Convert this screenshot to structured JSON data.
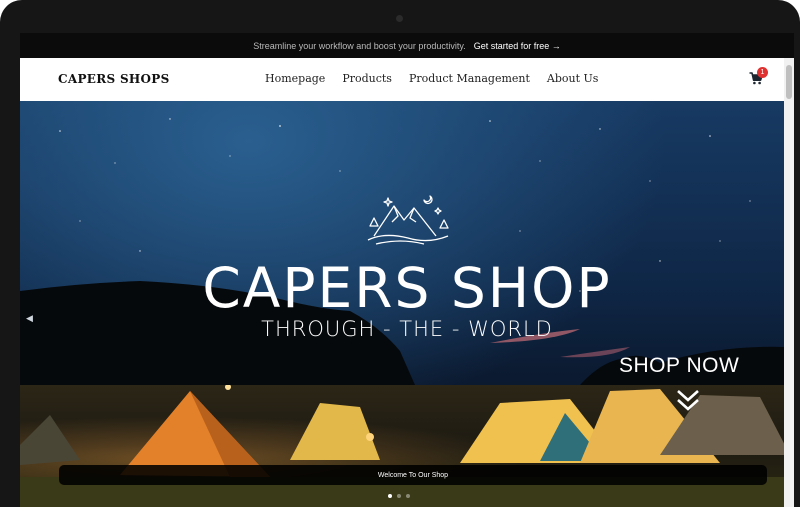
{
  "promo": {
    "text": "Streamline your workflow and boost your productivity.",
    "cta": "Get started for free",
    "cta_arrow": "→"
  },
  "nav": {
    "brand": "CAPERS SHOPS",
    "items": [
      {
        "label": "Homepage"
      },
      {
        "label": "Products"
      },
      {
        "label": "Product Management"
      },
      {
        "label": "About Us"
      }
    ],
    "cart_icon": "shopping-cart-icon",
    "cart_count": "1"
  },
  "hero": {
    "title": "CAPERS SHOP",
    "subtitle": "THROUGH - THE - WORLD",
    "cta": "SHOP NOW",
    "banner_text": "Welcome To Our Shop",
    "slide_count": 3,
    "active_slide": 1,
    "prev_icon": "arrow-left-icon",
    "cta_icon": "chevron-down-icon",
    "logo_icon": "mountain-logo-icon"
  },
  "colors": {
    "promo_bg": "#0b0b0b",
    "nav_bg": "#ffffff",
    "badge": "#e03131",
    "sky": "#173a63"
  }
}
